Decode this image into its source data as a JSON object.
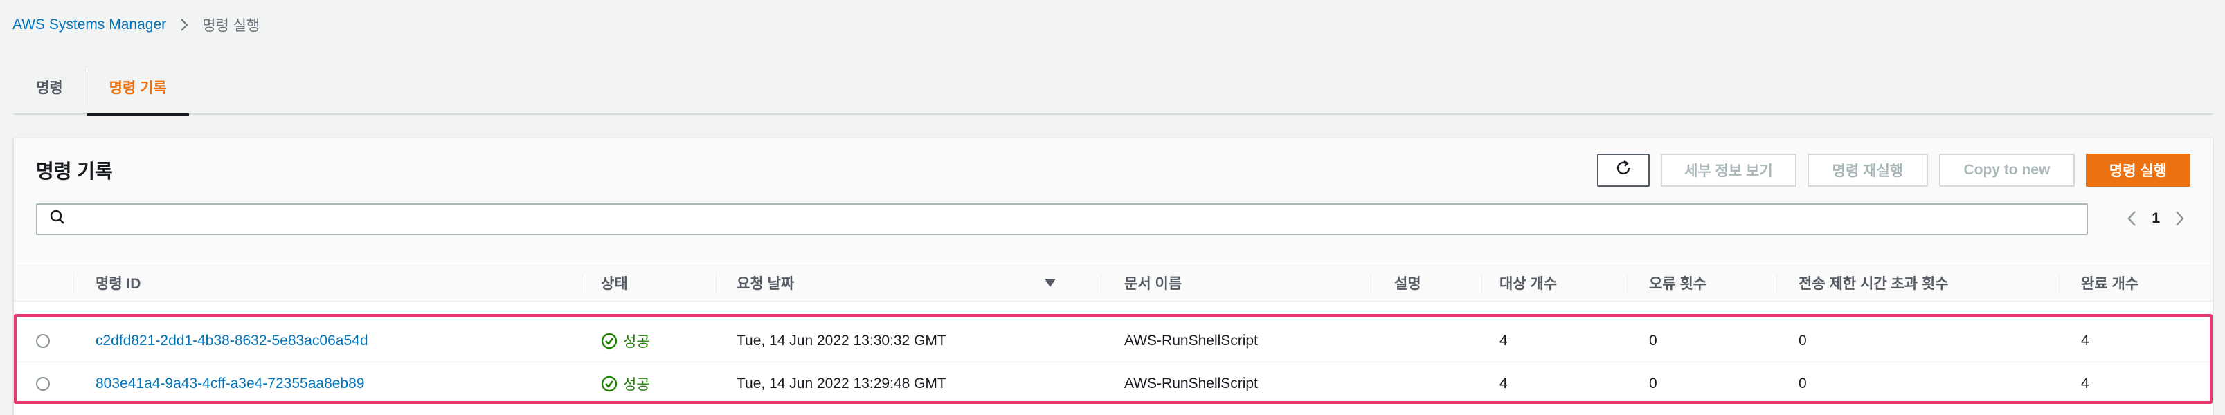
{
  "breadcrumb": {
    "root": "AWS Systems Manager",
    "current": "명령 실행"
  },
  "tabs": [
    {
      "label": "명령",
      "active": false
    },
    {
      "label": "명령 기록",
      "active": true
    }
  ],
  "panel": {
    "title": "명령 기록",
    "buttons": {
      "refresh_icon": "refresh-icon",
      "view_details": "세부 정보 보기",
      "rerun": "명령 재실행",
      "copy_to_new": "Copy to new",
      "run_command": "명령 실행"
    },
    "search": {
      "placeholder": "",
      "value": ""
    },
    "pagination": {
      "page": "1"
    }
  },
  "table": {
    "columns": [
      "명령 ID",
      "상태",
      "요청 날짜",
      "문서 이름",
      "설명",
      "대상 개수",
      "오류 횟수",
      "전송 제한 시간 초과 횟수",
      "완료 개수"
    ],
    "sorted_column": "요청 날짜",
    "rows": [
      {
        "command_id": "c2dfd821-2dd1-4b38-8632-5e83ac06a54d",
        "status": "성공",
        "requested": "Tue, 14 Jun 2022 13:30:32 GMT",
        "document": "AWS-RunShellScript",
        "description": "",
        "targets": "4",
        "errors": "0",
        "delivery_timeouts": "0",
        "completed": "4"
      },
      {
        "command_id": "803e41a4-9a43-4cff-a3e4-72355aa8eb89",
        "status": "성공",
        "requested": "Tue, 14 Jun 2022 13:29:48 GMT",
        "document": "AWS-RunShellScript",
        "description": "",
        "targets": "4",
        "errors": "0",
        "delivery_timeouts": "0",
        "completed": "4"
      }
    ]
  },
  "colors": {
    "accent": "#ec7211",
    "link": "#0073bb",
    "success": "#1d8102",
    "highlight": "#e8386d"
  }
}
